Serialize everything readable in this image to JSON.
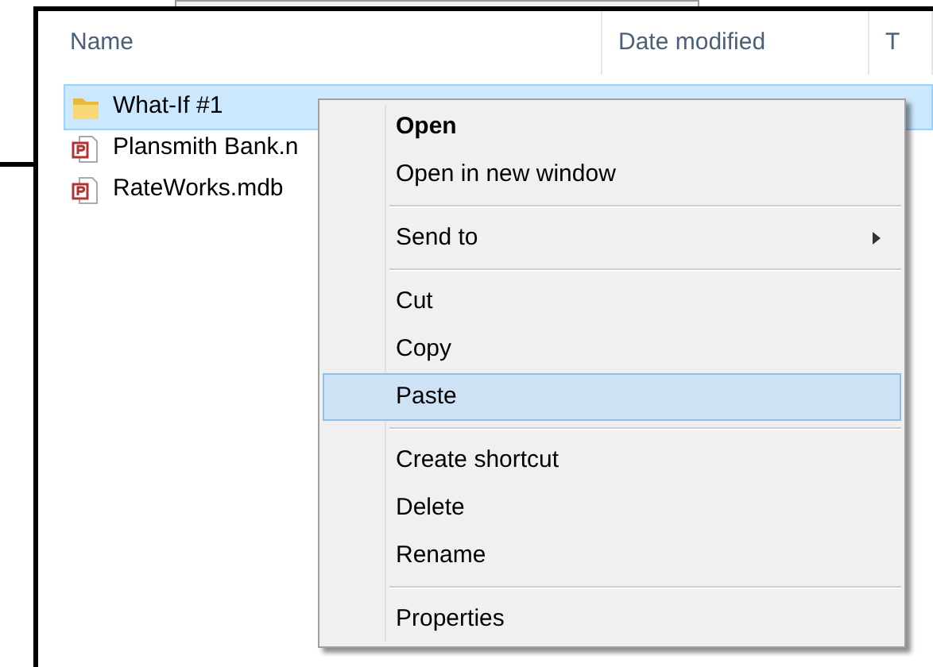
{
  "columns": [
    {
      "label": "Name"
    },
    {
      "label": "Date modified"
    },
    {
      "label": "T"
    }
  ],
  "files": [
    {
      "name": "What-If #1",
      "kind": "folder",
      "selected": true
    },
    {
      "name": "Plansmith Bank.n",
      "kind": "access",
      "selected": false
    },
    {
      "name": "RateWorks.mdb",
      "kind": "access",
      "selected": false
    }
  ],
  "context_menu": [
    {
      "kind": "item",
      "label": "Open",
      "default": true,
      "selected": false
    },
    {
      "kind": "item",
      "label": "Open in new window",
      "default": false,
      "selected": false
    },
    {
      "kind": "separator"
    },
    {
      "kind": "submenu",
      "label": "Send to",
      "default": false,
      "selected": false
    },
    {
      "kind": "separator"
    },
    {
      "kind": "item",
      "label": "Cut",
      "default": false,
      "selected": false
    },
    {
      "kind": "item",
      "label": "Copy",
      "default": false,
      "selected": false
    },
    {
      "kind": "item",
      "label": "Paste",
      "default": false,
      "selected": true
    },
    {
      "kind": "separator"
    },
    {
      "kind": "item",
      "label": "Create shortcut",
      "default": false,
      "selected": false
    },
    {
      "kind": "item",
      "label": "Delete",
      "default": false,
      "selected": false
    },
    {
      "kind": "item",
      "label": "Rename",
      "default": false,
      "selected": false
    },
    {
      "kind": "separator"
    },
    {
      "kind": "item",
      "label": "Properties",
      "default": false,
      "selected": false
    }
  ]
}
